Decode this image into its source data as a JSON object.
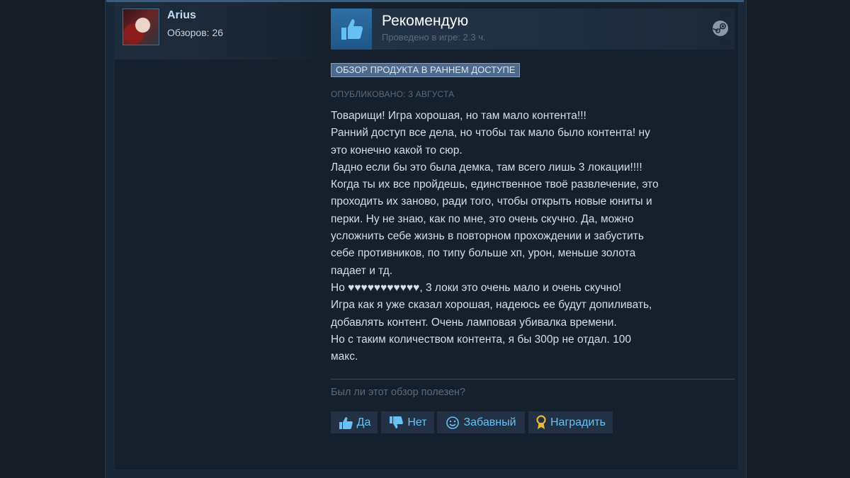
{
  "author": {
    "name": "Arius",
    "reviews_label": "Обзоров: 26"
  },
  "review": {
    "verdict": "Рекомендую",
    "hours": "Проведено в игре: 2.3 ч.",
    "early_access_badge": "ОБЗОР ПРОДУКТА В РАННЕМ ДОСТУПЕ",
    "posted": "ОПУБЛИКОВАНО: 3 АВГУСТА",
    "lines": [
      "Товарищи! Игра хорошая, но там мало контента!!!",
      "Ранний доступ все дела, но чтобы так мало было контента! ну",
      "это конечно какой то сюр.",
      "Ладно если бы это была демка, там всего лишь 3 локации!!!!",
      "Когда ты их все пройдешь, единственное твоё развлечение, это",
      "проходить их заново, ради того, чтобы открыть новые юниты и",
      "перки. Ну не знаю, как по мне, это очень скучно. Да, можно",
      "усложнить себе жизнь в повторном прохождении и забустить",
      "себе противников, по типу больше хп, урон, меньше золота",
      "падает и тд.",
      "Но ♥♥♥♥♥♥♥♥♥♥♥, 3 локи это очень мало и очень скучно!",
      "Игра как я уже сказал хорошая, надеюсь ее будут допиливать,",
      "добавлять контент. Очень ламповая убивалка времени.",
      "Но с таким количеством контента, я бы 300р не отдал. 100",
      "макс."
    ]
  },
  "feedback": {
    "question": "Был ли этот обзор полезен?",
    "yes_label": "Да",
    "no_label": "Нет",
    "funny_label": "Забавный",
    "award_label": "Наградить"
  },
  "icons": {
    "verdict": "thumbs-up-icon",
    "platform": "steam-icon",
    "yes": "thumbs-up-icon",
    "no": "thumbs-down-icon",
    "funny": "smiley-icon",
    "award": "award-ribbon-icon"
  },
  "colors": {
    "background": "#1b2838",
    "card": "#16202d",
    "accent": "#67c1f5",
    "username": "#c1dbf4",
    "badge": "#4b6a8c"
  }
}
